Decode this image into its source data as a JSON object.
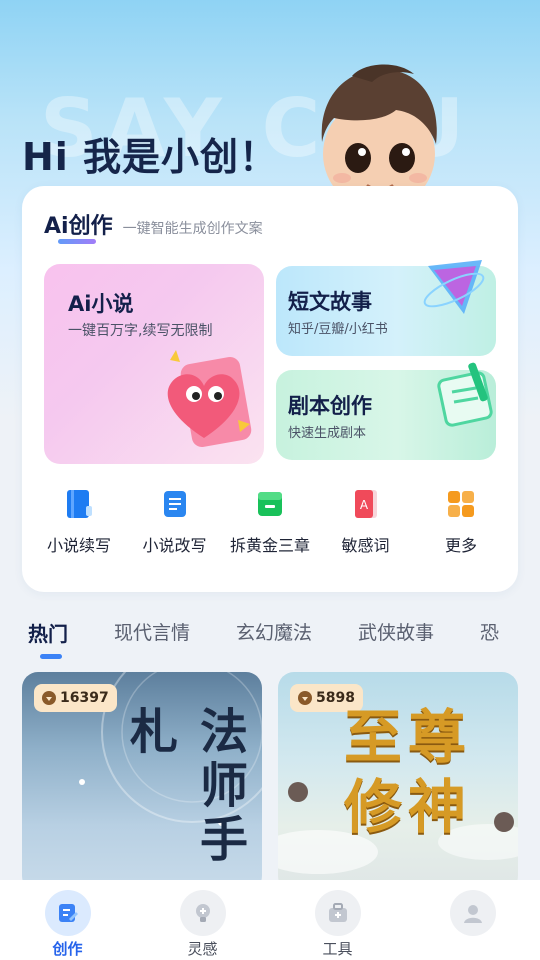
{
  "hero": {
    "watermark": "SAY CHU",
    "greeting": "Hi 我是小创！"
  },
  "ai_card": {
    "title": "Ai创作",
    "subtitle": "一键智能生成创作文案",
    "tiles": {
      "novel": {
        "title": "Ai小说",
        "desc": "一键百万字,续写无限制"
      },
      "short_story": {
        "title": "短文故事",
        "desc": "知乎/豆瓣/小红书"
      },
      "script": {
        "title": "剧本创作",
        "desc": "快速生成剧本"
      }
    },
    "tools": [
      {
        "label": "小说续写",
        "icon": "book-icon",
        "color": "#1e7cf2"
      },
      {
        "label": "小说改写",
        "icon": "scroll-icon",
        "color": "#2a86f0"
      },
      {
        "label": "拆黄金三章",
        "icon": "box-icon",
        "color": "#19c15a"
      },
      {
        "label": "敏感词",
        "icon": "warning-book-icon",
        "color": "#f04a5a"
      },
      {
        "label": "更多",
        "icon": "grid-icon",
        "color": "#f59a1e"
      }
    ]
  },
  "tabs": [
    "热门",
    "现代言情",
    "玄幻魔法",
    "武侠故事",
    "恐"
  ],
  "active_tab": "热门",
  "books": [
    {
      "count": "16397",
      "title": "法师手札"
    },
    {
      "count": "5898",
      "title": "至尊修神"
    }
  ],
  "bottom_nav": [
    {
      "label": "创作",
      "icon": "edit-icon",
      "active": true
    },
    {
      "label": "灵感",
      "icon": "lightbulb-icon",
      "active": false
    },
    {
      "label": "工具",
      "icon": "toolbox-icon",
      "active": false
    },
    {
      "label": "",
      "icon": "profile-icon",
      "active": false
    }
  ],
  "colors": {
    "accent": "#2563eb",
    "heading": "#13204a",
    "badge_bg": "#fbe6c8"
  }
}
